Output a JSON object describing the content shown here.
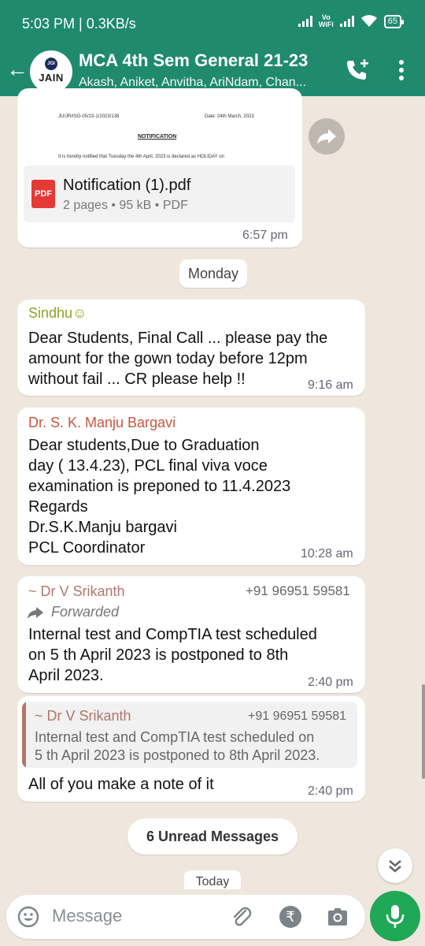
{
  "status": {
    "time_speed": "5:03 PM | 0.3KB/s",
    "vowifi_line1": "Vo",
    "vowifi_line2": "WiFi",
    "battery": "65"
  },
  "header": {
    "avatar_top": "JGI",
    "avatar_text": "JAIN",
    "title": "MCA 4th Sem General 21-23",
    "subtitle": "Akash, Aniket, Anvitha, AriNdam, Chan..."
  },
  "doc_message": {
    "preview_ref": "JU/JR/ISO-05/23-1/2023/138",
    "preview_date": "Date: 24th March, 2023",
    "preview_heading": "NOTIFICATION",
    "preview_line": "It is hereby notified that Tuesday the 4th April, 2023 is declared as HOLIDAY on",
    "file_name": "Notification (1).pdf",
    "file_meta": "2 pages • 95 kB • PDF",
    "icon_label": "PDF",
    "time": "6:57 pm"
  },
  "date_chip_1": "Monday",
  "messages": [
    {
      "sender": "Sindhu☺",
      "lines": [
        "Dear Students, Final Call ... please pay the",
        "amount for the gown today before 12pm",
        "without fail ... CR please help !!"
      ],
      "time": "9:16 am"
    },
    {
      "sender": "Dr. S. K. Manju Bargavi",
      "lines": [
        "Dear students,Due to Graduation",
        "day ( 13.4.23), PCL final viva voce",
        "examination is preponed to 11.4.2023",
        "Regards",
        "Dr.S.K.Manju bargavi",
        "PCL Coordinator"
      ],
      "time": "10:28 am"
    },
    {
      "sender": "~ Dr V Srikanth",
      "phone": "+91 96951 59581",
      "forwarded": "Forwarded",
      "lines": [
        "Internal test and CompTIA test scheduled",
        "on 5 th April 2023 is postponed to 8th",
        "April 2023."
      ],
      "time": "2:40 pm"
    },
    {
      "reply_sender": "~ Dr V Srikanth",
      "reply_phone": "+91 96951 59581",
      "reply_lines": [
        "Internal test and CompTIA test scheduled on",
        "5 th April 2023 is postponed to 8th April 2023."
      ],
      "lines": [
        "All of you make a note of it"
      ],
      "time": "2:40 pm"
    }
  ],
  "unread_label": "6 Unread Messages",
  "date_chip_2": "Today",
  "composer": {
    "placeholder": "Message",
    "rupee": "₹"
  },
  "colors": {
    "header": "#1f8a6e",
    "mic": "#1fa855",
    "sindhu": "#8ca428",
    "bargavi": "#c8553d",
    "srikanth": "#b2766c"
  }
}
